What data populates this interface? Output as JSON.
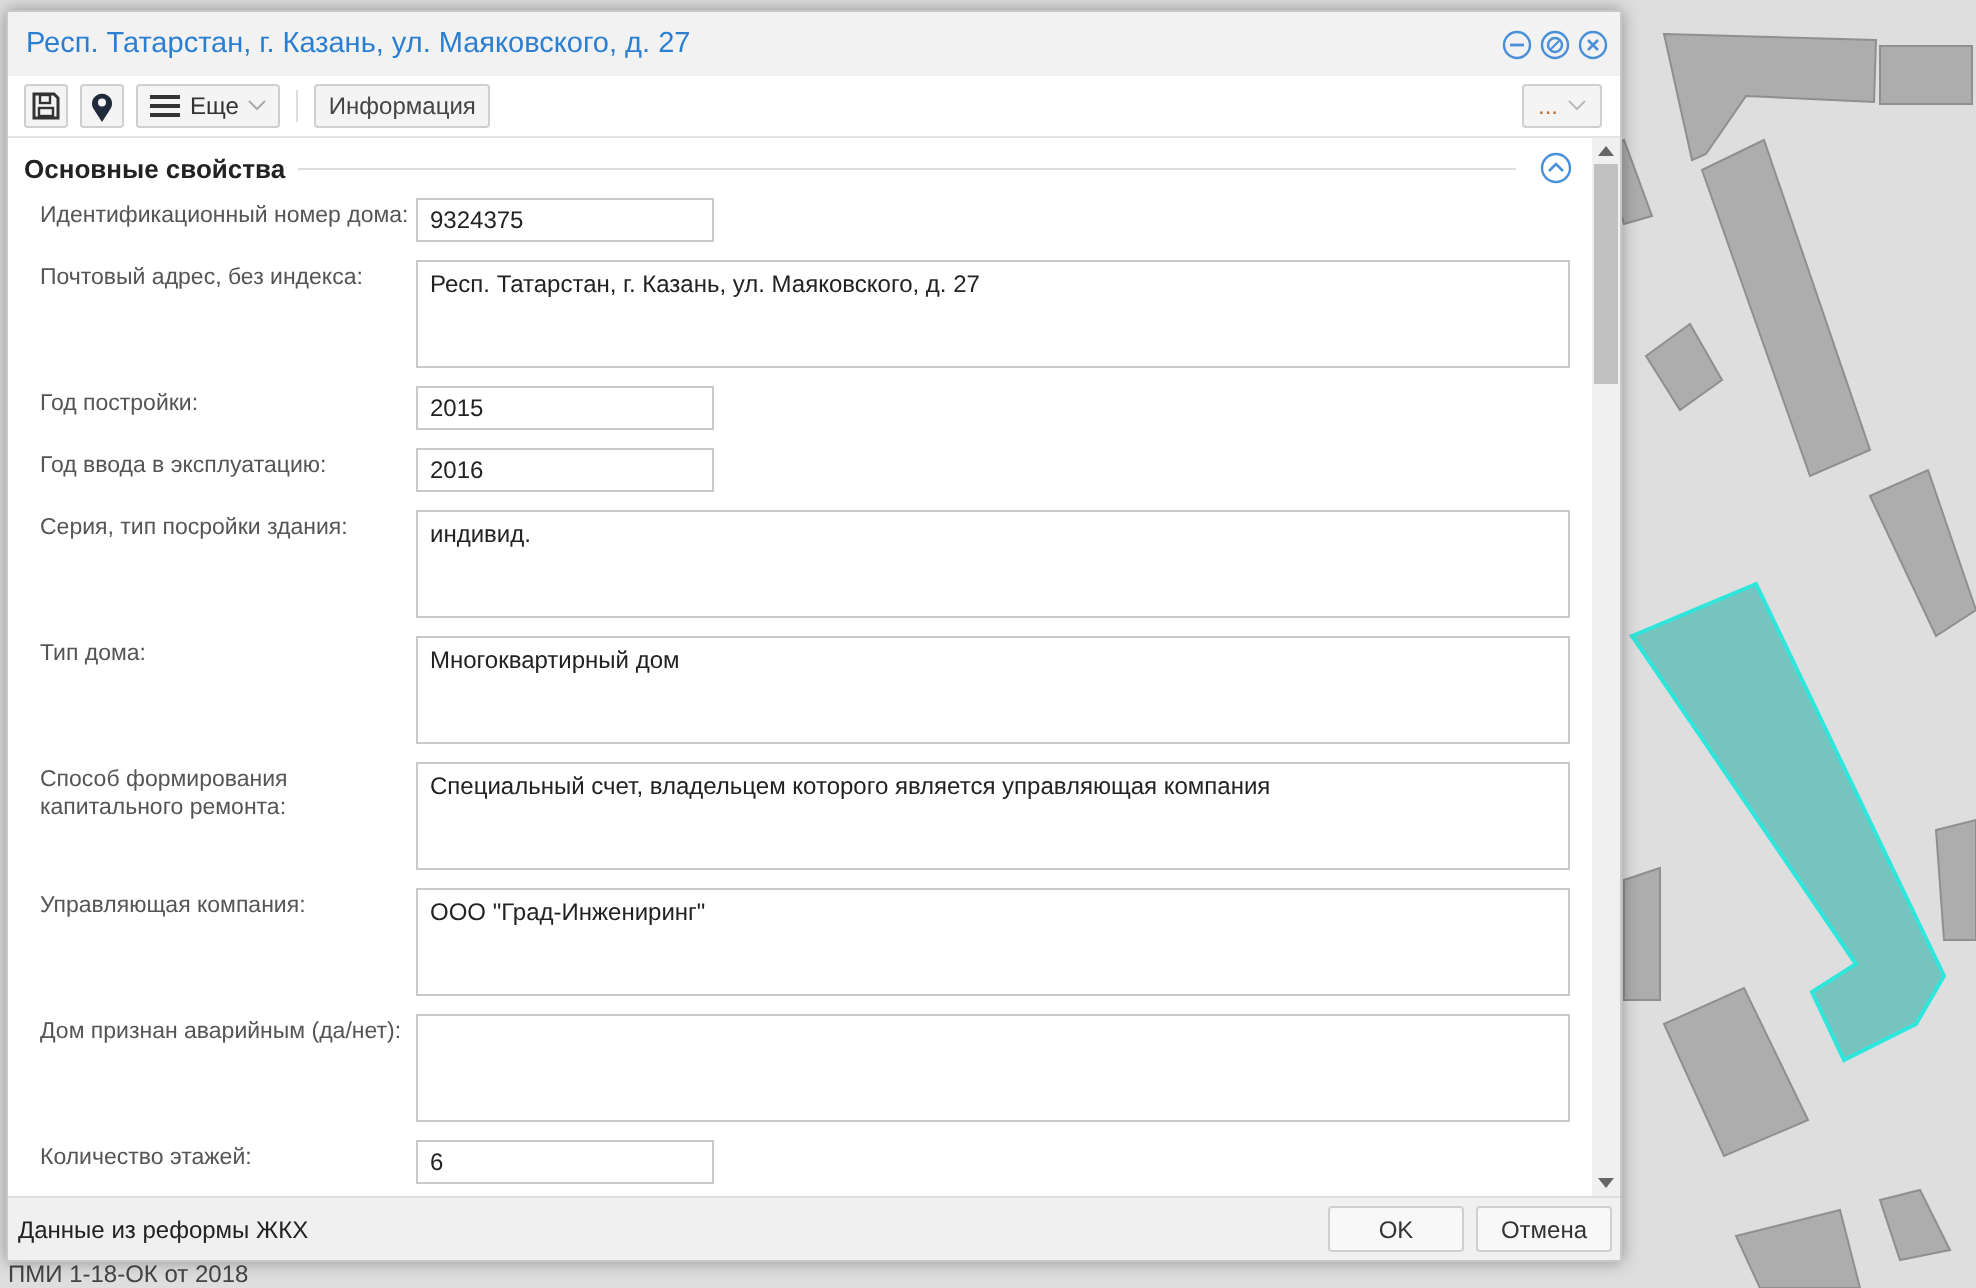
{
  "background_label": "ПМИ 1-18-ОК от 2018",
  "dialog": {
    "title": "Респ. Татарстан, г. Казань, ул. Маяковского, д. 27",
    "toolbar": {
      "more_button": "Еще",
      "info_button": "Информация",
      "overflow_button": "..."
    },
    "section": {
      "title": "Основные свойства",
      "expanded": true
    },
    "fields": [
      {
        "label": "Идентификационный номер дома:",
        "kind": "short",
        "value": "9324375"
      },
      {
        "label": "Почтовый адрес, без индекса:",
        "kind": "area",
        "value": "Респ. Татарстан, г. Казань, ул. Маяковского, д. 27"
      },
      {
        "label": "Год постройки:",
        "kind": "short",
        "value": "2015"
      },
      {
        "label": "Год ввода в эксплуатацию:",
        "kind": "short",
        "value": "2016"
      },
      {
        "label": "Серия, тип посройки здания:",
        "kind": "area",
        "value": "индивид."
      },
      {
        "label": "Тип дома:",
        "kind": "area",
        "value": "Многоквартирный дом"
      },
      {
        "label": "Способ формирования капитального ремонта:",
        "kind": "area",
        "value": "Специальный счет, владельцем которого является управляющая компания"
      },
      {
        "label": "Управляющая компания:",
        "kind": "area",
        "value": "ООО \"Град-Инжениринг\""
      },
      {
        "label": "Дом признан аварийным (да/нет):",
        "kind": "area"
      },
      {
        "label": "Количество этажей:",
        "kind": "short",
        "value": "6"
      }
    ],
    "footer": {
      "source": "Данные из реформы ЖКХ",
      "ok_button": "OK",
      "cancel_button": "Отмена"
    }
  }
}
